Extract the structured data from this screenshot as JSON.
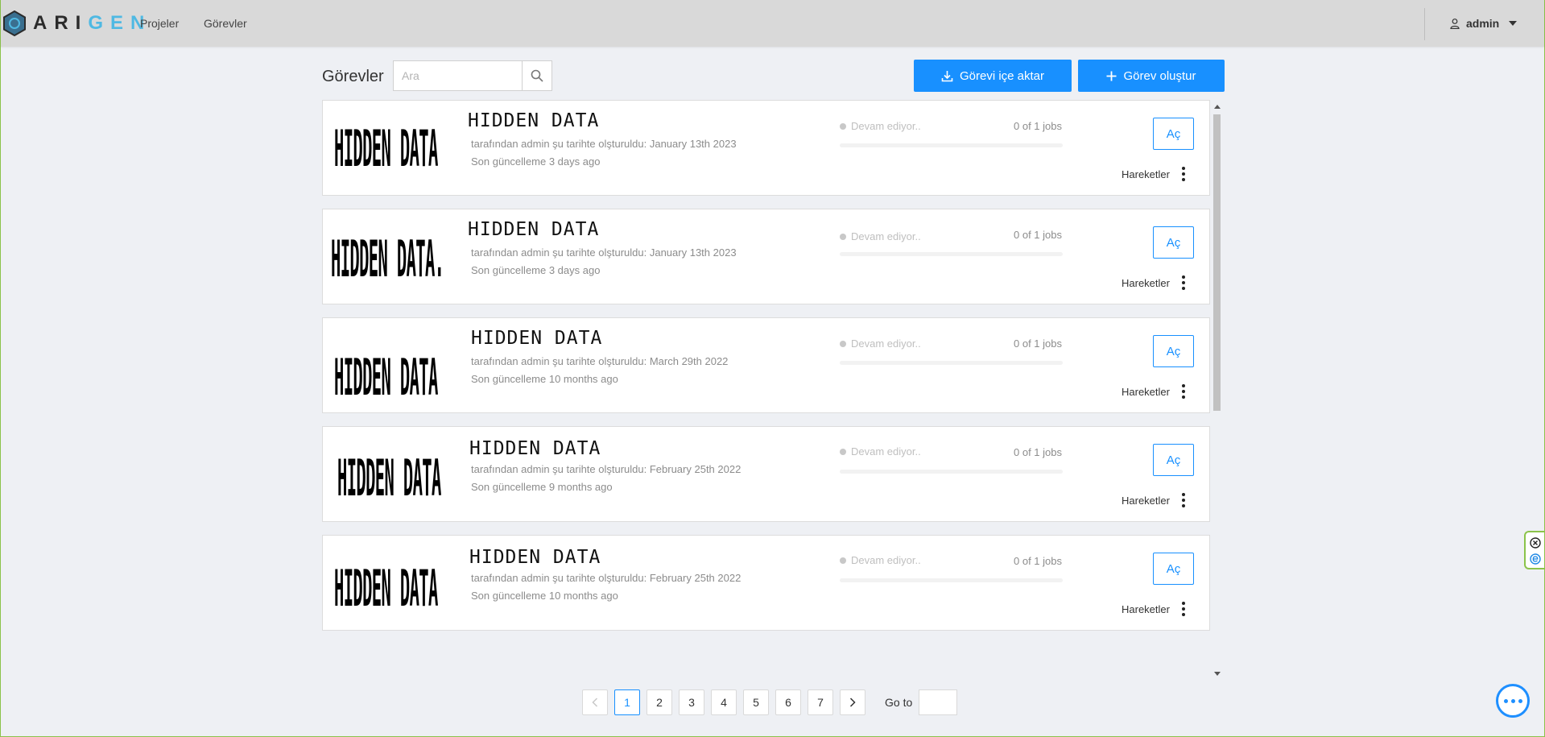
{
  "header": {
    "logo_dark": "ARI",
    "logo_light": "GEN",
    "nav": [
      "Projeler",
      "Görevler"
    ],
    "user": "admin"
  },
  "toolbar": {
    "title": "Görevler",
    "search_placeholder": "Ara",
    "import_label": "Görevi içe aktar",
    "create_label": "Görev oluştur"
  },
  "tasks": [
    {
      "thumb_text": "HIDDEN DATA",
      "name": "HIDDEN DATA",
      "created": "tarafından admin şu tarihte olşturuldu: January 13th 2023",
      "updated": "Son güncelleme 3 days ago",
      "status": "Devam ediyor..",
      "jobs": "0 of 1 jobs",
      "progress": 0,
      "open_label": "Aç",
      "actions_label": "Hareketler"
    },
    {
      "thumb_text": "HIDDEN DATA.",
      "name": "HIDDEN DATA",
      "created": "tarafından admin şu tarihte olşturuldu: January 13th 2023",
      "updated": "Son güncelleme 3 days ago",
      "status": "Devam ediyor..",
      "jobs": "0 of 1 jobs",
      "progress": 0,
      "open_label": "Aç",
      "actions_label": "Hareketler"
    },
    {
      "thumb_text": "HIDDEN DATA",
      "name": "HIDDEN DATA",
      "created": "tarafından admin şu tarihte olşturuldu: March 29th 2022",
      "updated": "Son güncelleme 10 months ago",
      "status": "Devam ediyor..",
      "jobs": "0 of 1 jobs",
      "progress": 0,
      "open_label": "Aç",
      "actions_label": "Hareketler"
    },
    {
      "thumb_text": "HIDDEN DATA",
      "name": "HIDDEN DATA",
      "created": "tarafından admin şu tarihte olşturuldu: February 25th 2022",
      "updated": "Son güncelleme 9 months ago",
      "status": "Devam ediyor..",
      "jobs": "0 of 1 jobs",
      "progress": 0,
      "open_label": "Aç",
      "actions_label": "Hareketler"
    },
    {
      "thumb_text": "HIDDEN DATA",
      "name": "HIDDEN DATA",
      "created": "tarafından admin şu tarihte olşturuldu: February 25th 2022",
      "updated": "Son güncelleme 10 months ago",
      "status": "Devam ediyor..",
      "jobs": "0 of 1 jobs",
      "progress": 0,
      "open_label": "Aç",
      "actions_label": "Hareketler"
    }
  ],
  "pagination": {
    "prev_icon": "chevron-left-icon",
    "pages": [
      "1",
      "2",
      "3",
      "4",
      "5",
      "6",
      "7"
    ],
    "current": "1",
    "next_icon": "chevron-right-icon",
    "goto_label": "Go to"
  },
  "colors": {
    "primary": "#1890ff",
    "header_bg": "#d9d9d9",
    "page_bg": "#eef0f4",
    "logo_accent": "#4fb9e3"
  }
}
